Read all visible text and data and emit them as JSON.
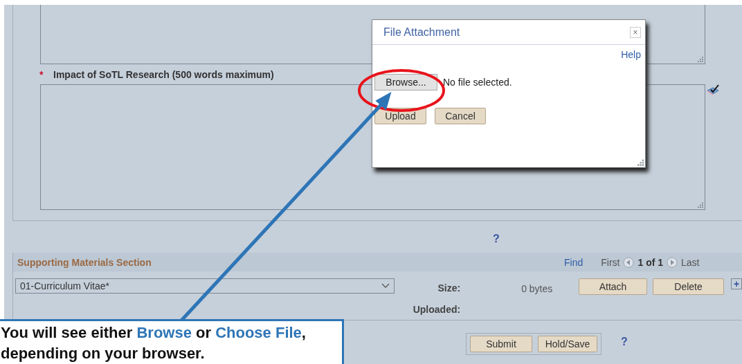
{
  "essay_field": {
    "required_mark": "*",
    "label": "Impact of SoTL Research (500 words maximum)"
  },
  "help_mark": "?",
  "supporting_materials": {
    "title": "Supporting Materials Section",
    "find": "Find",
    "first": "First",
    "counter": "1 of 1",
    "last": "Last",
    "document_type": "01-Curriculum Vitae*",
    "size_label": "Size:",
    "size_value": "0 bytes",
    "uploaded_label": "Uploaded:",
    "buttons": [
      "Attach",
      "Delete"
    ],
    "add": "+"
  },
  "actions": {
    "buttons": [
      "Submit",
      "Hold/Save"
    ],
    "help": "?"
  },
  "dialog": {
    "title": "File Attachment",
    "close": "×",
    "help": "Help",
    "browse": "Browse...",
    "file_status": "No file selected.",
    "buttons": [
      "Upload",
      "Cancel"
    ]
  },
  "callout": {
    "segments": [
      {
        "text": "You will see either ",
        "highlight": false
      },
      {
        "text": "Browse",
        "highlight": true
      },
      {
        "text": " or ",
        "highlight": false
      },
      {
        "text": "Choose File",
        "highlight": true
      },
      {
        "text": ", depending on your browser.",
        "highlight": false
      }
    ]
  }
}
